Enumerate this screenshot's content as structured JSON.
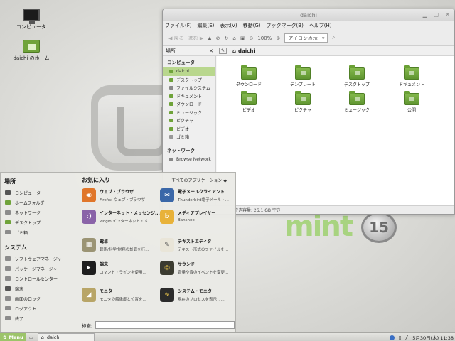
{
  "desktop": {
    "icons": [
      {
        "label": "コンピュータ"
      },
      {
        "label": "daichi のホーム"
      }
    ],
    "wallpaper_badge": "15"
  },
  "file_manager": {
    "title": "daichi",
    "menu": [
      "ファイル(F)",
      "編集(E)",
      "表示(V)",
      "移動(G)",
      "ブックマーク(B)",
      "ヘルプ(H)"
    ],
    "toolbar": {
      "back": "◀ 戻る",
      "forward": "進む ▶",
      "zoom": "100%",
      "view_mode": "アイコン表示"
    },
    "location_label": "場所",
    "path": "daichi",
    "sidebar": {
      "computer_header": "コンピュータ",
      "items": [
        "daichi",
        "デスクトップ",
        "ファイルシステム",
        "ドキュメント",
        "ダウンロード",
        "ミュージック",
        "ピクチャ",
        "ビデオ",
        "ゴミ箱"
      ],
      "network_header": "ネットワーク",
      "network_items": [
        "Browse Network"
      ]
    },
    "folders": [
      "ダウンロード",
      "テンプレート",
      "デスクトップ",
      "ドキュメント",
      "ビデオ",
      "ピクチャ",
      "ミュージック",
      "公開"
    ],
    "status": "空き容量: 26.1 GB 空き"
  },
  "start_menu": {
    "places_header": "場所",
    "places": [
      "コンピュータ",
      "ホームフォルダ",
      "ネットワーク",
      "デスクトップ",
      "ゴミ箱"
    ],
    "system_header": "システム",
    "system": [
      "ソフトウェアマネージャ",
      "パッケージマネージャ",
      "コントロールセンター",
      "端末",
      "画面のロック",
      "ログアウト",
      "終了"
    ],
    "favorites_header": "お気に入り",
    "all_apps": "すべてのアプリケーション",
    "apps": [
      {
        "name": "ウェブ・ブラウザ",
        "desc": "Firefox ウェブ・ブラウザ"
      },
      {
        "name": "電子メールクライアント",
        "desc": "Thunderbird電子メール・..."
      },
      {
        "name": "インターネット・メッセンジ...",
        "desc": "Pidgin インターネット・メ..."
      },
      {
        "name": "メディアプレイヤー",
        "desc": "Banshee"
      },
      {
        "name": "電卓",
        "desc": "算術/科学/財務の計算を行..."
      },
      {
        "name": "テキストエディタ",
        "desc": "テキスト形式のファイルを..."
      },
      {
        "name": "端末",
        "desc": "コマンド・ラインを使用..."
      },
      {
        "name": "サウンド",
        "desc": "音量や音のイベントを変更..."
      },
      {
        "name": "モニタ",
        "desc": "モニタの解像度と位置を..."
      },
      {
        "name": "システム・モニタ",
        "desc": "現在のプロセスを表示し..."
      }
    ],
    "search_label": "検索:",
    "search_value": ""
  },
  "panel": {
    "menu_label": "Menu",
    "task_label": "daichi",
    "clock": "5月30日(木) 11:38"
  }
}
